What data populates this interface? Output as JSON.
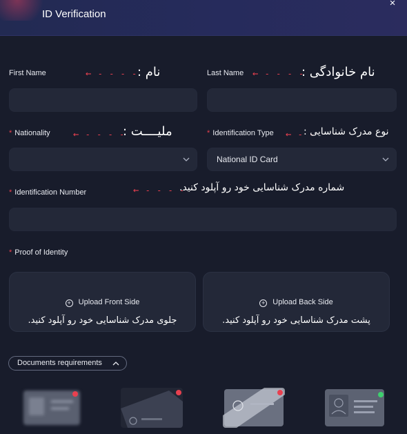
{
  "header": {
    "title": "ID Verification",
    "close_icon": "×"
  },
  "fields": {
    "first_name": {
      "label": "First Name",
      "note": "نام :",
      "value": ""
    },
    "last_name": {
      "label": "Last Name",
      "note": "نام خانوادگی :",
      "value": ""
    },
    "nationality": {
      "label": "Nationality",
      "note": "ملیــــت :",
      "value": ""
    },
    "id_type": {
      "label": "Identification Type",
      "note": "نوع مدرک شناسایی :",
      "value": "National ID Card"
    },
    "id_number": {
      "label": "Identification Number",
      "note": "شماره مدرک شناسایی خود رو آپلود کنید.",
      "value": ""
    },
    "proof": {
      "label": "Proof of Identity"
    }
  },
  "uploads": {
    "front": {
      "label": "Upload Front Side",
      "note": "جلوی مدرک شناسایی خود رو آپلود کنید."
    },
    "back": {
      "label": "Upload Back Side",
      "note": "پشت مدرک شناسایی خود رو آپلود کنید."
    }
  },
  "documents": {
    "label": "Documents requirements"
  },
  "colors": {
    "required": "#e8404f",
    "accent_header": "#262b5c",
    "ok_badge": "#3ecf6e"
  }
}
